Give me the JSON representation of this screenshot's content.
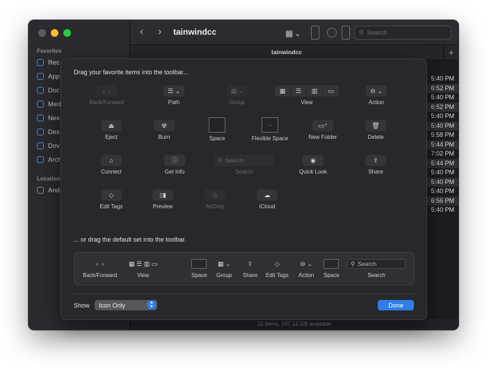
{
  "sidebar": {
    "favorites_label": "Favorites",
    "favorites": [
      "Rec",
      "App",
      "Doc",
      "Med",
      "Nex",
      "Des",
      "Dov",
      "Arch"
    ],
    "locations_label": "Location",
    "locations": [
      "And"
    ]
  },
  "window": {
    "title": "tainwindcc",
    "tab_title": "tainwindcc",
    "search_placeholder": "Search",
    "status": "15 items, 197.12 GB available",
    "times": [
      "5:40 PM",
      "6:52 PM",
      "5:40 PM",
      "6:52 PM",
      "5:40 PM",
      "5:40 PM",
      "5:58 PM",
      "5:44 PM",
      "7:02 PM",
      "5:44 PM",
      "5:40 PM",
      "5:40 PM",
      "5:40 PM",
      "6:56 PM",
      "5:40 PM"
    ]
  },
  "customize": {
    "heading": "Drag your favorite items into the toolbar...",
    "items": {
      "back_forward": "Back/Forward",
      "path": "Path",
      "group": "Group",
      "view": "View",
      "action": "Action",
      "eject": "Eject",
      "burn": "Burn",
      "space": "Space",
      "flexible_space": "Flexible Space",
      "new_folder": "New Folder",
      "delete": "Delete",
      "connect": "Connect",
      "get_info": "Get Info",
      "search": "Search",
      "search_placeholder": "Search",
      "quick_look": "Quick Look",
      "share": "Share",
      "edit_tags": "Edit Tags",
      "preview": "Preview",
      "airdrop": "AirDrop",
      "icloud": "iCloud"
    },
    "default_heading": "... or drag the default set into the toolbar.",
    "default_set": {
      "back_forward": "Back/Forward",
      "view": "View",
      "space": "Space",
      "group": "Group",
      "share": "Share",
      "edit_tags": "Edit Tags",
      "action": "Action",
      "space2": "Space",
      "search": "Search",
      "search_placeholder": "Search"
    },
    "show_label": "Show",
    "show_value": "Icon Only",
    "done_label": "Done"
  },
  "colors": {
    "accent": "#2f7de8",
    "close": "#ff5f57",
    "minimize": "#febc2e",
    "zoom": "#28c840"
  }
}
